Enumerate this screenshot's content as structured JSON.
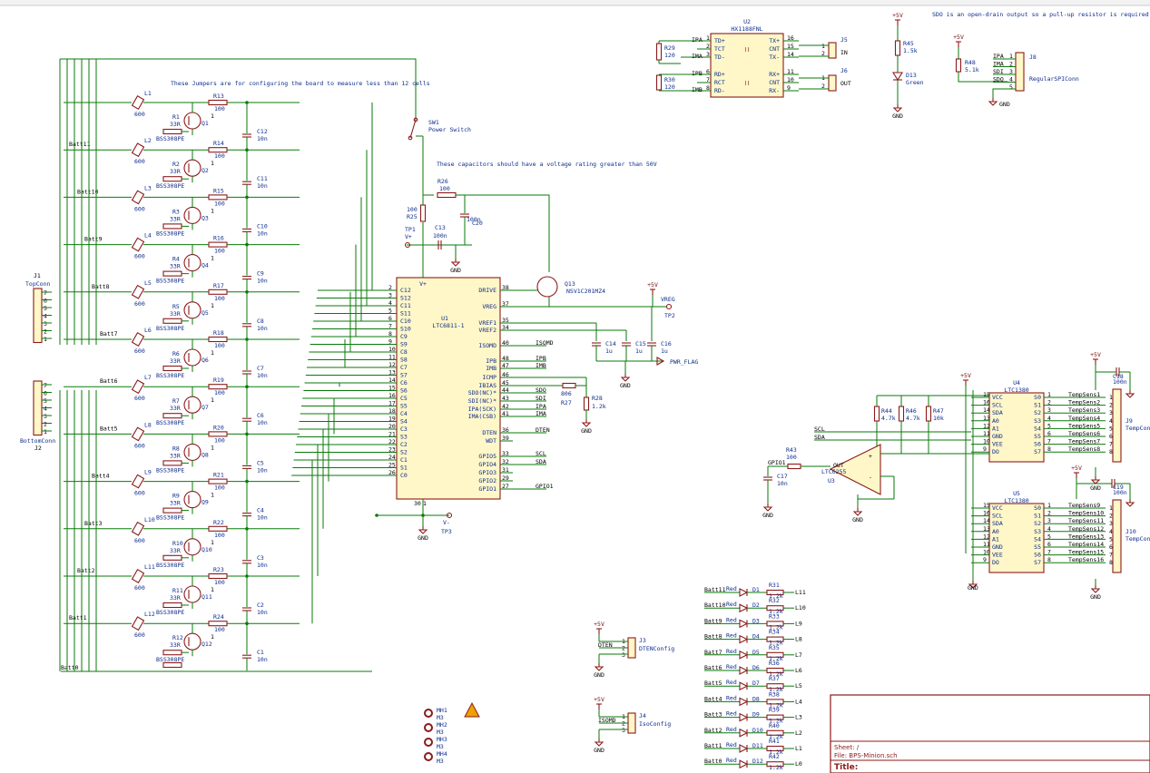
{
  "notes": {
    "jumpers": "These Jumpers are for configuring the board to measure less than 12 cells",
    "caps": "These capacitors should have a voltage rating greater than 50V",
    "sdo": "SDO is an open-drain output so a pull-up resistor is required for regular SPI."
  },
  "power": {
    "p5v": "+5V",
    "gnd": "GND",
    "vminus": "V-",
    "vplus": "V+",
    "pwr_flag": "PWR_FLAG"
  },
  "cells": [
    {
      "l": "L1",
      "r": "R13",
      "c": "C12",
      "q": "Q1",
      "rg": "R1",
      "batt": ""
    },
    {
      "l": "L2",
      "r": "R14",
      "c": "C11",
      "q": "Q2",
      "rg": "R2",
      "batt": "Batt11"
    },
    {
      "l": "L3",
      "r": "R15",
      "c": "C10",
      "q": "Q3",
      "rg": "R3",
      "batt": "Batt10"
    },
    {
      "l": "L4",
      "r": "R16",
      "c": "C9",
      "q": "Q4",
      "rg": "R4",
      "batt": "Batt9"
    },
    {
      "l": "L5",
      "r": "R17",
      "c": "C8",
      "q": "Q5",
      "rg": "R5",
      "batt": "Batt8"
    },
    {
      "l": "L6",
      "r": "R18",
      "c": "C7",
      "q": "Q6",
      "rg": "R6",
      "batt": "Batt7"
    },
    {
      "l": "L7",
      "r": "R19",
      "c": "C6",
      "q": "Q7",
      "rg": "R7",
      "batt": "Batt6"
    },
    {
      "l": "L8",
      "r": "R20",
      "c": "C5",
      "q": "Q8",
      "rg": "R8",
      "batt": "Batt5"
    },
    {
      "l": "L9",
      "r": "R21",
      "c": "C4",
      "q": "Q9",
      "rg": "R9",
      "batt": "Batt4"
    },
    {
      "l": "L10",
      "r": "R22",
      "c": "C3",
      "q": "Q10",
      "rg": "R10",
      "batt": "Batt3"
    },
    {
      "l": "L11",
      "r": "R23",
      "c": "C2",
      "q": "Q11",
      "rg": "R11",
      "batt": "Batt2"
    },
    {
      "l": "L12",
      "r": "R24",
      "c": "C1",
      "q": "Q12",
      "rg": "R12",
      "batt": "Batt1"
    }
  ],
  "cell_values": {
    "l": "600",
    "r": "100",
    "c": "10n",
    "rg": "33R",
    "q": "BSS308PE"
  },
  "batt0": "Batt0",
  "j1": {
    "ref": "J1",
    "name": "TopConn",
    "pins": [
      "7",
      "6",
      "5",
      "4",
      "3",
      "2",
      "1"
    ]
  },
  "j2": {
    "ref": "J2",
    "name": "BottomConn",
    "pins": [
      "7",
      "6",
      "5",
      "4",
      "3",
      "2",
      "1"
    ]
  },
  "u1": {
    "ref": "U1",
    "name": "LTC6811-1",
    "top_pin": "V+",
    "left_pins": [
      {
        "n": "2",
        "l": "C12"
      },
      {
        "n": "3",
        "l": "S12"
      },
      {
        "n": "4",
        "l": "C11"
      },
      {
        "n": "5",
        "l": "S11"
      },
      {
        "n": "6",
        "l": "C10"
      },
      {
        "n": "7",
        "l": "S10"
      },
      {
        "n": "8",
        "l": "C9"
      },
      {
        "n": "9",
        "l": "S9"
      },
      {
        "n": "10",
        "l": "C8"
      },
      {
        "n": "11",
        "l": "S8"
      },
      {
        "n": "12",
        "l": "C7"
      },
      {
        "n": "13",
        "l": "S7"
      },
      {
        "n": "14",
        "l": "C6"
      },
      {
        "n": "15",
        "l": "S6"
      },
      {
        "n": "16",
        "l": "C5"
      },
      {
        "n": "17",
        "l": "S5"
      },
      {
        "n": "18",
        "l": "C4"
      },
      {
        "n": "19",
        "l": "S4"
      },
      {
        "n": "20",
        "l": "C3"
      },
      {
        "n": "21",
        "l": "S3"
      },
      {
        "n": "22",
        "l": "C2"
      },
      {
        "n": "23",
        "l": "S2"
      },
      {
        "n": "24",
        "l": "C1"
      },
      {
        "n": "25",
        "l": "S1"
      },
      {
        "n": "26",
        "l": "C0"
      }
    ],
    "right_pins": [
      {
        "n": "38",
        "l": "DRIVE",
        "net": ""
      },
      {
        "n": "37",
        "l": "VREG",
        "net": ""
      },
      {
        "n": "35",
        "l": "VREF1",
        "net": ""
      },
      {
        "n": "34",
        "l": "VREF2",
        "net": ""
      },
      {
        "n": "40",
        "l": "ISOMD",
        "net": "ISOMD"
      },
      {
        "n": "48",
        "l": "IPB",
        "net": "IPB"
      },
      {
        "n": "47",
        "l": "IMB",
        "net": "IMB"
      },
      {
        "n": "46",
        "l": "ICMP",
        "net": ""
      },
      {
        "n": "45",
        "l": "IBIAS",
        "net": ""
      },
      {
        "n": "44",
        "l": "SDO(NC)*",
        "net": "SDO"
      },
      {
        "n": "43",
        "l": "SDI(NC)*",
        "net": "SDI"
      },
      {
        "n": "42",
        "l": "IPA(SCK)",
        "net": "IPA"
      },
      {
        "n": "41",
        "l": "IMA(CSB)",
        "net": "IMA"
      },
      {
        "n": "36",
        "l": "DTEN",
        "net": "DTEN"
      },
      {
        "n": "39",
        "l": "WDT",
        "net": ""
      },
      {
        "n": "33",
        "l": "GPIO5",
        "net": "SCL"
      },
      {
        "n": "32",
        "l": "GPIO4",
        "net": "SDA"
      },
      {
        "n": "31",
        "l": "GPIO3",
        "net": ""
      },
      {
        "n": "29",
        "l": "GPIO2",
        "net": ""
      },
      {
        "n": "27",
        "l": "GPIO1",
        "net": "GPIO1"
      }
    ],
    "bottom_pins": [
      "30",
      "1"
    ]
  },
  "parts": {
    "sw1": "SW1",
    "sw1_name": "Power Switch",
    "r26": "R26",
    "r26_val": "100",
    "r25": "R25",
    "r25_val": "100",
    "c13": "C13",
    "c13_val": "100n",
    "c20": "C20",
    "c20_val": "100n",
    "tp1": "TP1",
    "tp2": "TP2",
    "tp3": "TP3",
    "q13": "Q13",
    "q13_name": "NSV1C201MZ4",
    "vreg": "VREG",
    "c14": "C14",
    "c14_val": "1u",
    "c15": "C15",
    "c15_val": "1u",
    "c16": "C16",
    "c16_val": "1u",
    "r27": "R27",
    "r27_val": "806",
    "r28": "R28",
    "r28_val": "1.2k"
  },
  "u2": {
    "ref": "U2",
    "name": "HX1188FNL",
    "pins_l": [
      {
        "n": "1",
        "l": "TD+"
      },
      {
        "n": "2",
        "l": "TCT"
      },
      {
        "n": "3",
        "l": "TD-"
      },
      {
        "n": "6",
        "l": "RD+"
      },
      {
        "n": "7",
        "l": "RCT"
      },
      {
        "n": "8",
        "l": "RD-"
      }
    ],
    "pins_r": [
      {
        "n": "16",
        "l": "TX+"
      },
      {
        "n": "15",
        "l": "CNT"
      },
      {
        "n": "14",
        "l": "TX-"
      },
      {
        "n": "11",
        "l": "RX+"
      },
      {
        "n": "10",
        "l": "CNT"
      },
      {
        "n": "9",
        "l": "RX-"
      }
    ],
    "nets": [
      "IPA",
      "IMA",
      "IPB",
      "IMB"
    ],
    "r29": "R29",
    "r29_val": "120",
    "r30": "R30",
    "r30_val": "120",
    "j5": "J5",
    "j5_name": "IN",
    "j6": "J6",
    "j6_name": "OUT"
  },
  "status_led": {
    "r": "R45",
    "r_val": "1.5k",
    "d": "D13",
    "d_val": "Green"
  },
  "j8": {
    "ref": "J8",
    "name": "RegularSPIConn",
    "r": "R48",
    "r_val": "5.1k",
    "nets": [
      "IPA",
      "IMA",
      "SDI",
      "SDO"
    ],
    "pins": [
      "1",
      "2",
      "3",
      "4",
      "5"
    ]
  },
  "temp": {
    "u4": "U4",
    "u5": "U5",
    "mux": "LTC1380",
    "mux_left": [
      {
        "n": "15",
        "l": "VCC"
      },
      {
        "n": "16",
        "l": "SCL"
      },
      {
        "n": "14",
        "l": "SDA"
      },
      {
        "n": "13",
        "l": "A0"
      },
      {
        "n": "12",
        "l": "A1"
      },
      {
        "n": "11",
        "l": "GND"
      },
      {
        "n": "10",
        "l": "VEE"
      },
      {
        "n": "9",
        "l": "DO"
      }
    ],
    "mux_right": [
      {
        "n": "1",
        "l": "S0"
      },
      {
        "n": "2",
        "l": "S1"
      },
      {
        "n": "3",
        "l": "S2"
      },
      {
        "n": "4",
        "l": "S3"
      },
      {
        "n": "5",
        "l": "S4"
      },
      {
        "n": "6",
        "l": "S5"
      },
      {
        "n": "7",
        "l": "S6"
      },
      {
        "n": "8",
        "l": "S7"
      }
    ],
    "sens_a": [
      "TempSens1",
      "TempSens2",
      "TempSens3",
      "TempSens4",
      "TempSens5",
      "TempSens6",
      "TempSens7",
      "TempSens8"
    ],
    "sens_b": [
      "TempSens9",
      "TempSens10",
      "TempSens11",
      "TempSens12",
      "TempSens13",
      "TempSens14",
      "TempSens15",
      "TempSens16"
    ],
    "j9": "J9",
    "j10": "J10",
    "tconn": "TempConn",
    "c18": "C18",
    "c19": "C19",
    "cval": "100n",
    "r44": "R44",
    "r44_val": "4.7k",
    "r46": "R46",
    "r46_val": "4.7k",
    "r47": "R47",
    "r47_val": "10k",
    "u3": "U3",
    "u3_name": "LTC6255",
    "r43": "R43",
    "r43_val": "100",
    "c17": "C17",
    "c17_val": "10n",
    "scl": "SCL",
    "sda": "SDA",
    "gpio1": "GPIO1",
    "out": "OUT"
  },
  "config": {
    "j3": "J3",
    "j3_name": "DTENConfig",
    "j3_net": "DTEN",
    "j4": "J4",
    "j4_name": "IsoConfig",
    "j4_net": "ISOMD"
  },
  "leds": [
    {
      "b": "Batt11",
      "d": "D1",
      "r": "R31",
      "l": "L11"
    },
    {
      "b": "Batt10",
      "d": "D2",
      "r": "R32",
      "l": "L10"
    },
    {
      "b": "Batt9",
      "d": "D3",
      "r": "R33",
      "l": "L9"
    },
    {
      "b": "Batt8",
      "d": "D4",
      "r": "R34",
      "l": "L8"
    },
    {
      "b": "Batt7",
      "d": "D5",
      "r": "R35",
      "l": "L7"
    },
    {
      "b": "Batt6",
      "d": "D6",
      "r": "R36",
      "l": "L6"
    },
    {
      "b": "Batt5",
      "d": "D7",
      "r": "R37",
      "l": "L5"
    },
    {
      "b": "Batt4",
      "d": "D8",
      "r": "R38",
      "l": "L4"
    },
    {
      "b": "Batt3",
      "d": "D9",
      "r": "R39",
      "l": "L3"
    },
    {
      "b": "Batt2",
      "d": "D10",
      "r": "R40",
      "l": "L2"
    },
    {
      "b": "Batt1",
      "d": "D11",
      "r": "R41",
      "l": "L1"
    },
    {
      "b": "Batt0",
      "d": "D12",
      "r": "R42",
      "l": "L0"
    }
  ],
  "led_values": {
    "color": "Red",
    "r": "1.2k"
  },
  "holes": [
    {
      "ref": "MH1",
      "val": "M3"
    },
    {
      "ref": "MH2",
      "val": "M3"
    },
    {
      "ref": "MH3",
      "val": "M3"
    },
    {
      "ref": "MH4",
      "val": "M3"
    }
  ],
  "title_block": {
    "sheet": "Sheet: /",
    "file": "File: BPS-Minion.sch",
    "title": "Title:"
  }
}
